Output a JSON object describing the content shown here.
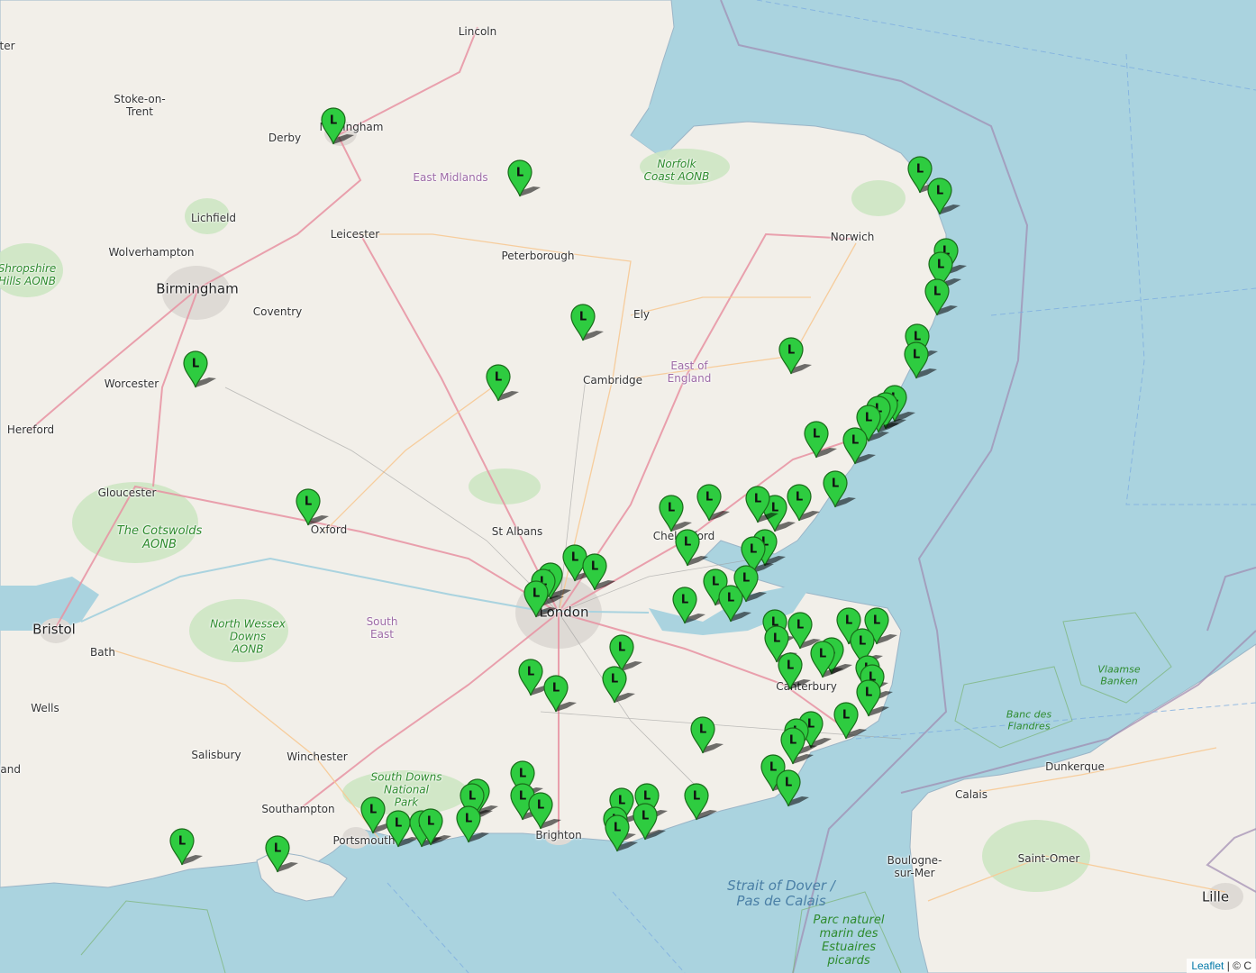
{
  "map": {
    "marker_letter": "L",
    "marker_color": "#2ecc40",
    "sea_color": "#aad3df",
    "land_color": "#f2efe9",
    "labels": {
      "lincoln": "Lincoln",
      "stoke": "Stoke-on-\nTrent",
      "derby": "Derby",
      "nottingham": "Nottingham",
      "east_midlands": "East Midlands",
      "norfolk_coast": "Norfolk\nCoast AONB",
      "lichfield": "Lichfield",
      "leicester": "Leicester",
      "norwich": "Norwich",
      "shropshire": "Shropshire\nHills AONB",
      "wolverhampton": "Wolverhampton",
      "peterborough": "Peterborough",
      "birmingham": "Birmingham",
      "coventry": "Coventry",
      "ely": "Ely",
      "east_of_england": "East of\nEngland",
      "worcester": "Worcester",
      "cambridge": "Cambridge",
      "hereford": "Hereford",
      "gloucester": "Gloucester",
      "cotswolds": "The Cotswolds\nAONB",
      "oxford": "Oxford",
      "st_albans": "St Albans",
      "chelmsford": "Chelmsford",
      "london": "London",
      "bristol": "Bristol",
      "north_wessex": "North Wessex\nDowns\nAONB",
      "south_east": "South\nEast",
      "bath": "Bath",
      "canterbury": "Canterbury",
      "wells": "Wells",
      "salisbury": "Salisbury",
      "winchester": "Winchester",
      "south_downs": "South Downs\nNational\nPark",
      "southampton": "Southampton",
      "portsmouth": "Portsmouth",
      "brighton": "Brighton",
      "vlaamse": "Vlaamse\nBanken",
      "banc": "Banc des\nFlandres",
      "dunkerque": "Dunkerque",
      "calais": "Calais",
      "boulogne": "Boulogne-\nsur-Mer",
      "saint_omer": "Saint-Omer",
      "lille": "Lille",
      "strait": "Strait of Dover /\nPas de Calais",
      "marin": "Parc naturel\nmarin des\nEstuaires\npicards",
      "left_ter": "ter",
      "left_land": "land"
    }
  },
  "attribution": {
    "leaflet": "Leaflet",
    "rest": " | © C"
  }
}
